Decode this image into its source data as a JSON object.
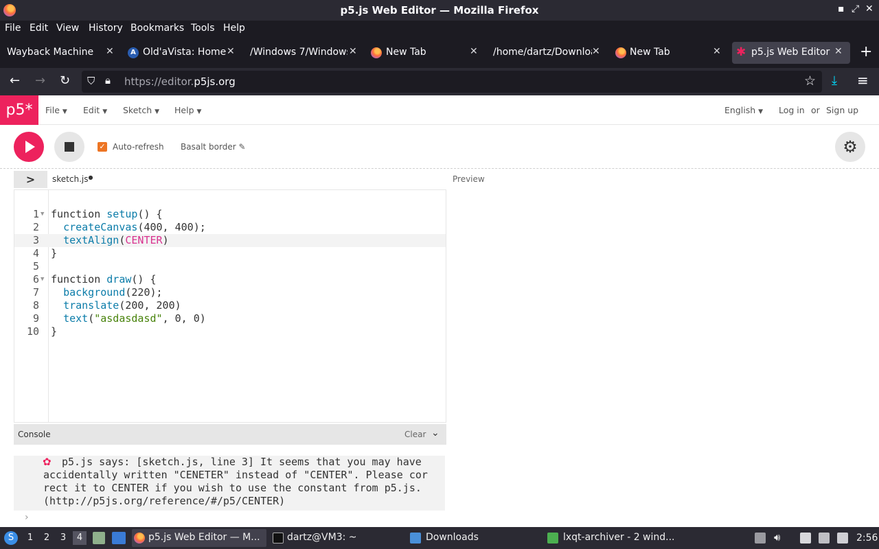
{
  "window": {
    "title": "p5.js Web Editor — Mozilla Firefox",
    "minimize": "▪",
    "maximize": "⤢",
    "close": "✕"
  },
  "menubar": [
    "File",
    "Edit",
    "View",
    "History",
    "Bookmarks",
    "Tools",
    "Help"
  ],
  "tabs": [
    {
      "label": "Wayback Machine",
      "icon": "none"
    },
    {
      "label": "Old'aVista: Home",
      "icon": "av-icon"
    },
    {
      "label": "/Windows 7/Windows",
      "icon": "none"
    },
    {
      "label": "New Tab",
      "icon": "firefox-icon"
    },
    {
      "label": "/home/dartz/Downloa",
      "icon": "none"
    },
    {
      "label": "New Tab",
      "icon": "firefox-icon"
    },
    {
      "label": "p5.js Web Editor",
      "icon": "p5-star-icon"
    }
  ],
  "tab_close": "✕",
  "new_tab": "+",
  "nav": {
    "back": "←",
    "forward": "→",
    "reload": "↻",
    "url_prefix": "https://editor.",
    "url_domain": "p5js.org",
    "bookmark": "☆",
    "download": "⤓",
    "menu": "≡"
  },
  "p5": {
    "logo": "p5*",
    "menus": [
      "File",
      "Edit",
      "Sketch",
      "Help"
    ],
    "language": "English",
    "login": "Log in",
    "or": "or",
    "signup": "Sign up",
    "auto_refresh": "Auto-refresh",
    "sketch_name": "Basalt border ✎",
    "file_tab": "sketch.js",
    "file_dot": "●",
    "preview": "Preview",
    "console": "Console",
    "clear": "Clear",
    "console_chevron": "⌄",
    "prompt": "›",
    "flower": "✿",
    "console_lines": [
      "p5.js says: [sketch.js, line 3] It seems that you may have",
      "accidentally written \"CENETER\" instead of \"CENTER\". Please cor",
      "rect it to CENTER if you wish to use the constant from p5.js.",
      "(http://p5js.org/reference/#/p5/CENTER)"
    ]
  },
  "code": {
    "active_line": 3,
    "lines": [
      {
        "n": "1",
        "fold": true,
        "tokens": [
          [
            "kw",
            "function "
          ],
          [
            "fn",
            "setup"
          ],
          [
            "kw",
            "() {"
          ]
        ]
      },
      {
        "n": "2",
        "fold": false,
        "tokens": [
          [
            "kw",
            "  "
          ],
          [
            "fn",
            "createCanvas"
          ],
          [
            "kw",
            "(400, 400);"
          ]
        ]
      },
      {
        "n": "3",
        "fold": false,
        "tokens": [
          [
            "kw",
            "  "
          ],
          [
            "fn",
            "textAlign"
          ],
          [
            "kw",
            "("
          ],
          [
            "cn",
            "CENTER"
          ],
          [
            "kw",
            ")"
          ]
        ]
      },
      {
        "n": "4",
        "fold": false,
        "tokens": [
          [
            "kw",
            "}"
          ]
        ]
      },
      {
        "n": "5",
        "fold": false,
        "tokens": []
      },
      {
        "n": "6",
        "fold": true,
        "tokens": [
          [
            "kw",
            "function "
          ],
          [
            "fn",
            "draw"
          ],
          [
            "kw",
            "() {"
          ]
        ]
      },
      {
        "n": "7",
        "fold": false,
        "tokens": [
          [
            "kw",
            "  "
          ],
          [
            "fn",
            "background"
          ],
          [
            "kw",
            "(220);"
          ]
        ]
      },
      {
        "n": "8",
        "fold": false,
        "tokens": [
          [
            "kw",
            "  "
          ],
          [
            "fn",
            "translate"
          ],
          [
            "kw",
            "(200, 200)"
          ]
        ]
      },
      {
        "n": "9",
        "fold": false,
        "tokens": [
          [
            "kw",
            "  "
          ],
          [
            "fn",
            "text"
          ],
          [
            "kw",
            "("
          ],
          [
            "st",
            "\"asdasdasd\""
          ],
          [
            "kw",
            ", 0, 0)"
          ]
        ]
      },
      {
        "n": "10",
        "fold": false,
        "tokens": [
          [
            "kw",
            "}"
          ]
        ]
      }
    ]
  },
  "taskbar": {
    "desktops": [
      "1",
      "2",
      "3",
      "4"
    ],
    "tasks": [
      {
        "label": "p5.js Web Editor — M..."
      },
      {
        "label": "dartz@VM3: ~"
      },
      {
        "label": "Downloads"
      },
      {
        "label": "lxqt-archiver - 2 wind..."
      }
    ],
    "clock": "2:56"
  }
}
